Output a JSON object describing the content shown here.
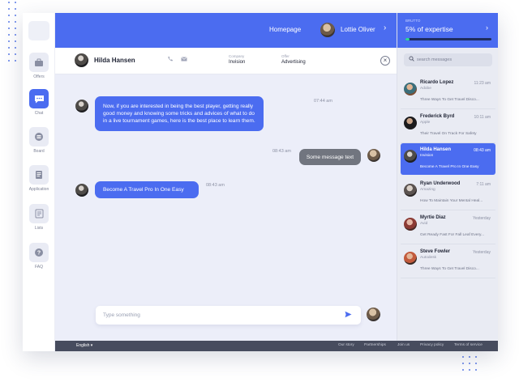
{
  "topbar": {
    "homepage_link": "Homepage",
    "user_name": "Lottie Oliver"
  },
  "sidebar": {
    "items": [
      {
        "label": "Offers",
        "icon": "briefcase-icon"
      },
      {
        "label": "Chat",
        "icon": "chat-icon",
        "active": true
      },
      {
        "label": "Board",
        "icon": "list-icon"
      },
      {
        "label": "Application",
        "icon": "document-icon"
      },
      {
        "label": "Lists",
        "icon": "clipboard-icon"
      },
      {
        "label": "FAQ",
        "icon": "question-icon"
      }
    ]
  },
  "chat_header": {
    "name": "Hilda Hansen",
    "company_label": "Company",
    "company_value": "Invision",
    "offer_label": "Offer",
    "offer_value": "Advertising"
  },
  "messages": [
    {
      "text": "Now, if you are interested in being the best player, getting really good money and knowing some tricks and advices of what to do in a live tournament games, here is the best place to learn them.",
      "time": "07:44 am",
      "side": "left"
    },
    {
      "text": "Some message text",
      "time": "08:43 am",
      "side": "right"
    },
    {
      "text": "Become A Travel Pro In One Easy",
      "time": "08:43 am",
      "side": "left"
    }
  ],
  "composer": {
    "placeholder": "Type something"
  },
  "expertise": {
    "label": "BRUTTO",
    "value_text": "5% of expertise",
    "progress": 0.05,
    "fill_color": "#2ed59a"
  },
  "search": {
    "placeholder": "search messages"
  },
  "conversations": [
    {
      "name": "Ricardo Lopez",
      "company": "Adobe",
      "time": "11:23 am",
      "preview": "Three Ways To Get Travel Disco..."
    },
    {
      "name": "Frederick Byrd",
      "company": "Apple",
      "time": "10:11 am",
      "preview": "Their Travel On Track For Safety"
    },
    {
      "name": "Hilda Hansen",
      "company": "Invision",
      "time": "08:43 am",
      "preview": "Become A Travel Pro In One Easy",
      "active": true
    },
    {
      "name": "Ryan Underwood",
      "company": "Amazing",
      "time": "7:11 am",
      "preview": "How To Maintain Your Mental Heal..."
    },
    {
      "name": "Myrtie Diaz",
      "company": "Avid",
      "time": "Yesterday",
      "preview": "Get Ready Fast For Fall Leaf Every..."
    },
    {
      "name": "Steve Fowler",
      "company": "Autodesk",
      "time": "Yesterday",
      "preview": "Three Ways To Get Travel Disco..."
    }
  ],
  "footer": {
    "language": "English",
    "links": [
      "Our story",
      "Partnerships",
      "Join us",
      "Privacy policy",
      "Terms of service"
    ]
  },
  "colors": {
    "accent": "#4b6cf0",
    "footer": "#474c5e",
    "main_bg": "#eceef9"
  }
}
